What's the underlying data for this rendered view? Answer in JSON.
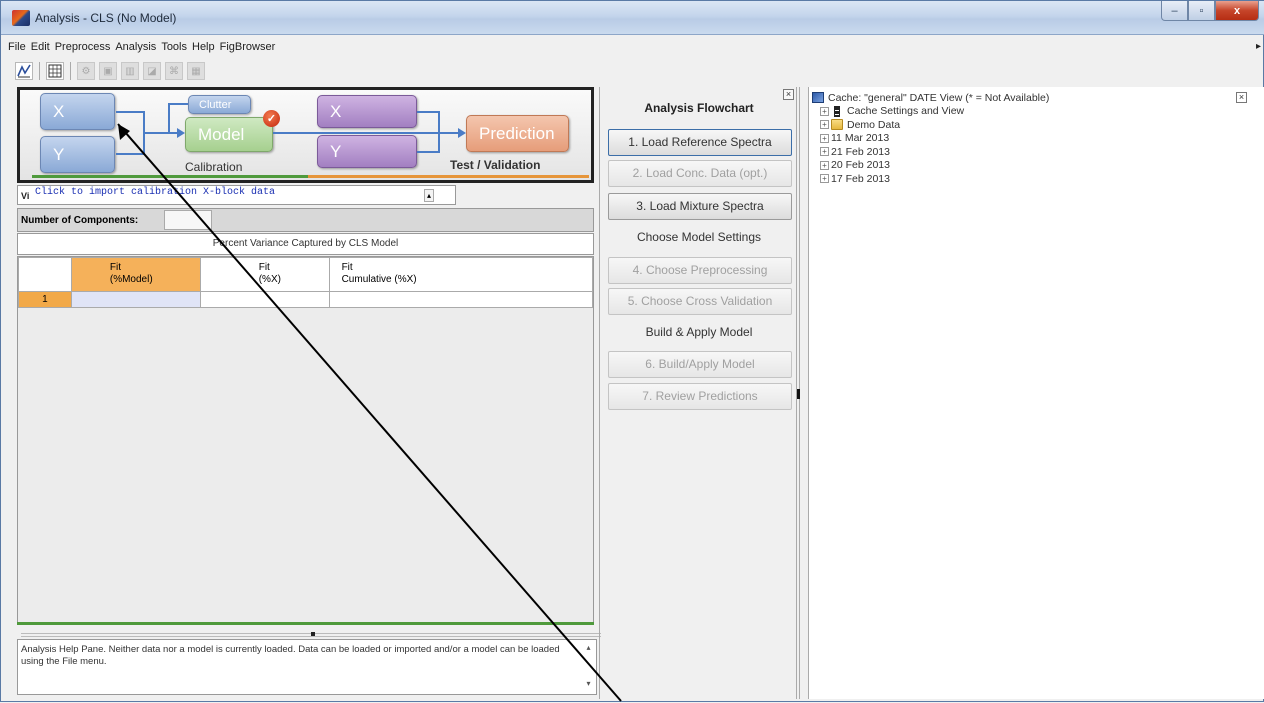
{
  "window": {
    "title": "Analysis - CLS (No Model)",
    "controls": {
      "minimize": "–",
      "maximize": "▫",
      "close": "x"
    }
  },
  "menu": [
    "File",
    "Edit",
    "Preprocess",
    "Analysis",
    "Tools",
    "Help",
    "FigBrowser"
  ],
  "toolbar": [
    "chart-icon",
    "spreadsheet-icon",
    "gear-icon",
    "lock-icon",
    "bar-icon",
    "data-icon",
    "model-icon",
    "grid-icon"
  ],
  "flowchart": {
    "x_block": "X",
    "y_block": "Y",
    "clutter": "Clutter",
    "model": "Model",
    "x_test": "X",
    "y_test": "Y",
    "prediction": "Prediction",
    "calibration_label": "Calibration",
    "test_label": "Test / Validation"
  },
  "status_hint": {
    "prefix": "Vi",
    "text": "Click to import calibration X-block data"
  },
  "components": {
    "label": "Number of Components:",
    "value": ""
  },
  "variance": {
    "title": "Percent Variance Captured by CLS Model",
    "columns": [
      {
        "line1": "Fit",
        "line2": "(%Model)"
      },
      {
        "line1": "Fit",
        "line2": "(%X)"
      },
      {
        "line1": "Fit",
        "line2": "Cumulative (%X)"
      }
    ],
    "rows": [
      {
        "n": "1"
      }
    ]
  },
  "help_pane": {
    "text": "Analysis Help Pane. Neither data nor a model is currently loaded. Data can be loaded or imported and/or a model can be loaded using the File menu."
  },
  "analysis_flowchart": {
    "title": "Analysis Flowchart",
    "steps": [
      {
        "label": "1. Load Reference Spectra",
        "enabled": true
      },
      {
        "label": "2. Load Conc. Data (opt.)",
        "enabled": false
      },
      {
        "label": "3. Load Mixture Spectra",
        "enabled": true
      }
    ],
    "section_settings": "Choose Model Settings",
    "settings_steps": [
      {
        "label": "4. Choose Preprocessing",
        "enabled": false
      },
      {
        "label": "5. Choose Cross Validation",
        "enabled": false
      }
    ],
    "section_build": "Build & Apply Model",
    "build_steps": [
      {
        "label": "6. Build/Apply Model",
        "enabled": false
      },
      {
        "label": "7. Review Predictions",
        "enabled": false
      }
    ]
  },
  "cache": {
    "header": "Cache: \"general\" DATE View (* = Not Available)",
    "items": [
      "Cache Settings and View",
      "Demo Data",
      "11 Mar 2013",
      "21 Feb 2013",
      "20 Feb 2013",
      "17 Feb 2013"
    ]
  },
  "colors": {
    "title_bar": "#c4d5ec",
    "flow_blue": "#8aa9d6",
    "flow_green": "#a6d08f",
    "flow_purple": "#a27fc1",
    "flow_orange": "#e69d7a",
    "row_header": "#f2a948",
    "hint_text": "#1a2fb2",
    "calibration_underline": "#4f9a3c",
    "test_underline": "#e6953a"
  }
}
